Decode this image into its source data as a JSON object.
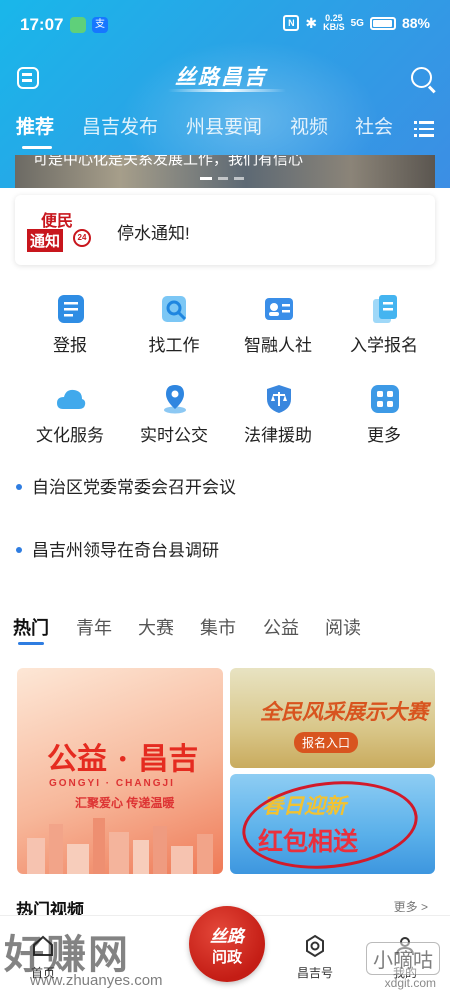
{
  "status_bar": {
    "time": "17:07",
    "net_speed_value": "0.25",
    "net_speed_unit": "KB/S",
    "signal": "5G",
    "battery": "88%"
  },
  "header": {
    "brand": "丝路昌吉",
    "tabs": [
      "推荐",
      "昌吉发布",
      "州县要闻",
      "视频",
      "社会"
    ],
    "active_tab": "推荐",
    "banner_caption": "可是中心化是关系发展工作，我们有信心"
  },
  "notice": {
    "logo_line1": "便民",
    "logo_line2": "通知",
    "logo_badge": "24",
    "text": "停水通知!"
  },
  "services": [
    {
      "label": "登报",
      "icon": "newspaper-icon",
      "color": "#2f8de4"
    },
    {
      "label": "找工作",
      "icon": "job-search-icon",
      "color": "#39a6ec"
    },
    {
      "label": "智融人社",
      "icon": "id-card-icon",
      "color": "#3a8ee8"
    },
    {
      "label": "入学报名",
      "icon": "enrollment-icon",
      "color": "#44b4f0"
    },
    {
      "label": "文化服务",
      "icon": "cloud-icon",
      "color": "#41a9ec"
    },
    {
      "label": "实时公交",
      "icon": "location-pin-icon",
      "color": "#2f86e0"
    },
    {
      "label": "法律援助",
      "icon": "legal-scale-icon",
      "color": "#3a87de"
    },
    {
      "label": "更多",
      "icon": "more-grid-icon",
      "color": "#3d9ae6"
    }
  ],
  "news": [
    "自治区党委常委会召开会议",
    "昌吉州领导在奇台县调研"
  ],
  "categories": [
    "热门",
    "青年",
    "大赛",
    "集市",
    "公益",
    "阅读"
  ],
  "active_category": "热门",
  "cards": {
    "card1_title": "公益 · 昌吉",
    "card1_pinyin": "GONGYI · CHANGJI",
    "card1_slogan": "汇聚爱心 传递温暖",
    "card2_title": "全民风采展示大赛",
    "card2_button": "报名入口",
    "card3_title": "春日迎新",
    "card3_subtitle": "红包相送"
  },
  "section": {
    "title": "热门视频",
    "more": "更多 >"
  },
  "bottom_nav": {
    "home": "首页",
    "center_line1": "丝路",
    "center_line2": "问政",
    "changji_hao": "昌吉号",
    "mine": "我的"
  },
  "watermarks": {
    "left": "好赚网",
    "left_url": "www.zhuanyes.com",
    "right": "小嘀咕",
    "right_url": "xdgit.com"
  }
}
